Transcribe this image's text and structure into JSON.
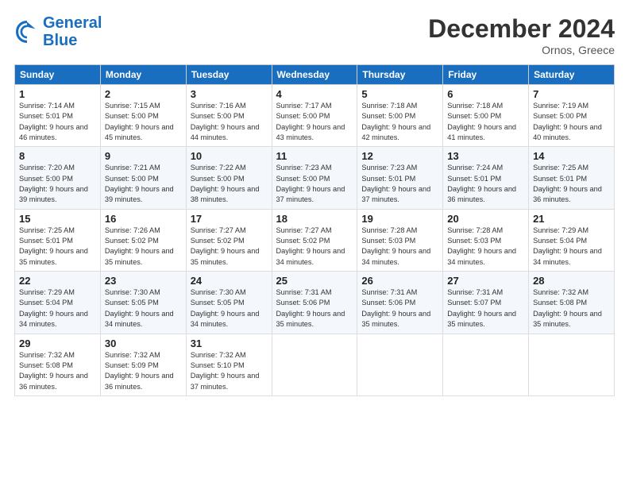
{
  "header": {
    "logo_line1": "General",
    "logo_line2": "Blue",
    "month": "December 2024",
    "location": "Ornos, Greece"
  },
  "days_of_week": [
    "Sunday",
    "Monday",
    "Tuesday",
    "Wednesday",
    "Thursday",
    "Friday",
    "Saturday"
  ],
  "weeks": [
    [
      {
        "day": 1,
        "sunrise": "7:14 AM",
        "sunset": "5:01 PM",
        "daylight": "9 hours and 46 minutes."
      },
      {
        "day": 2,
        "sunrise": "7:15 AM",
        "sunset": "5:00 PM",
        "daylight": "9 hours and 45 minutes."
      },
      {
        "day": 3,
        "sunrise": "7:16 AM",
        "sunset": "5:00 PM",
        "daylight": "9 hours and 44 minutes."
      },
      {
        "day": 4,
        "sunrise": "7:17 AM",
        "sunset": "5:00 PM",
        "daylight": "9 hours and 43 minutes."
      },
      {
        "day": 5,
        "sunrise": "7:18 AM",
        "sunset": "5:00 PM",
        "daylight": "9 hours and 42 minutes."
      },
      {
        "day": 6,
        "sunrise": "7:18 AM",
        "sunset": "5:00 PM",
        "daylight": "9 hours and 41 minutes."
      },
      {
        "day": 7,
        "sunrise": "7:19 AM",
        "sunset": "5:00 PM",
        "daylight": "9 hours and 40 minutes."
      }
    ],
    [
      {
        "day": 8,
        "sunrise": "7:20 AM",
        "sunset": "5:00 PM",
        "daylight": "9 hours and 39 minutes."
      },
      {
        "day": 9,
        "sunrise": "7:21 AM",
        "sunset": "5:00 PM",
        "daylight": "9 hours and 39 minutes."
      },
      {
        "day": 10,
        "sunrise": "7:22 AM",
        "sunset": "5:00 PM",
        "daylight": "9 hours and 38 minutes."
      },
      {
        "day": 11,
        "sunrise": "7:23 AM",
        "sunset": "5:00 PM",
        "daylight": "9 hours and 37 minutes."
      },
      {
        "day": 12,
        "sunrise": "7:23 AM",
        "sunset": "5:01 PM",
        "daylight": "9 hours and 37 minutes."
      },
      {
        "day": 13,
        "sunrise": "7:24 AM",
        "sunset": "5:01 PM",
        "daylight": "9 hours and 36 minutes."
      },
      {
        "day": 14,
        "sunrise": "7:25 AM",
        "sunset": "5:01 PM",
        "daylight": "9 hours and 36 minutes."
      }
    ],
    [
      {
        "day": 15,
        "sunrise": "7:25 AM",
        "sunset": "5:01 PM",
        "daylight": "9 hours and 35 minutes."
      },
      {
        "day": 16,
        "sunrise": "7:26 AM",
        "sunset": "5:02 PM",
        "daylight": "9 hours and 35 minutes."
      },
      {
        "day": 17,
        "sunrise": "7:27 AM",
        "sunset": "5:02 PM",
        "daylight": "9 hours and 35 minutes."
      },
      {
        "day": 18,
        "sunrise": "7:27 AM",
        "sunset": "5:02 PM",
        "daylight": "9 hours and 34 minutes."
      },
      {
        "day": 19,
        "sunrise": "7:28 AM",
        "sunset": "5:03 PM",
        "daylight": "9 hours and 34 minutes."
      },
      {
        "day": 20,
        "sunrise": "7:28 AM",
        "sunset": "5:03 PM",
        "daylight": "9 hours and 34 minutes."
      },
      {
        "day": 21,
        "sunrise": "7:29 AM",
        "sunset": "5:04 PM",
        "daylight": "9 hours and 34 minutes."
      }
    ],
    [
      {
        "day": 22,
        "sunrise": "7:29 AM",
        "sunset": "5:04 PM",
        "daylight": "9 hours and 34 minutes."
      },
      {
        "day": 23,
        "sunrise": "7:30 AM",
        "sunset": "5:05 PM",
        "daylight": "9 hours and 34 minutes."
      },
      {
        "day": 24,
        "sunrise": "7:30 AM",
        "sunset": "5:05 PM",
        "daylight": "9 hours and 34 minutes."
      },
      {
        "day": 25,
        "sunrise": "7:31 AM",
        "sunset": "5:06 PM",
        "daylight": "9 hours and 35 minutes."
      },
      {
        "day": 26,
        "sunrise": "7:31 AM",
        "sunset": "5:06 PM",
        "daylight": "9 hours and 35 minutes."
      },
      {
        "day": 27,
        "sunrise": "7:31 AM",
        "sunset": "5:07 PM",
        "daylight": "9 hours and 35 minutes."
      },
      {
        "day": 28,
        "sunrise": "7:32 AM",
        "sunset": "5:08 PM",
        "daylight": "9 hours and 35 minutes."
      }
    ],
    [
      {
        "day": 29,
        "sunrise": "7:32 AM",
        "sunset": "5:08 PM",
        "daylight": "9 hours and 36 minutes."
      },
      {
        "day": 30,
        "sunrise": "7:32 AM",
        "sunset": "5:09 PM",
        "daylight": "9 hours and 36 minutes."
      },
      {
        "day": 31,
        "sunrise": "7:32 AM",
        "sunset": "5:10 PM",
        "daylight": "9 hours and 37 minutes."
      },
      null,
      null,
      null,
      null
    ]
  ],
  "labels": {
    "sunrise": "Sunrise:",
    "sunset": "Sunset:",
    "daylight": "Daylight:"
  }
}
